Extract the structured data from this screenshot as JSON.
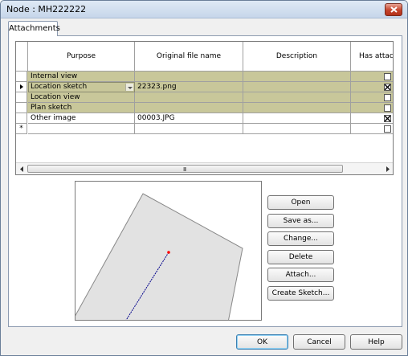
{
  "window": {
    "title": "Node : MH222222"
  },
  "tabs": [
    {
      "label": "Attachments"
    }
  ],
  "grid": {
    "columns": [
      "Purpose",
      "Original file name",
      "Description",
      "Has attachment"
    ],
    "rows": [
      {
        "purpose": "Internal view",
        "file": "",
        "description": "",
        "has_attachment": false,
        "highlighted": true
      },
      {
        "purpose": "Location sketch",
        "file": "22323.png",
        "description": "",
        "has_attachment": true,
        "highlighted": true,
        "current": true
      },
      {
        "purpose": "Location view",
        "file": "",
        "description": "",
        "has_attachment": false,
        "highlighted": true
      },
      {
        "purpose": "Plan sketch",
        "file": "",
        "description": "",
        "has_attachment": false,
        "highlighted": true
      },
      {
        "purpose": "Other image",
        "file": "00003.JPG",
        "description": "",
        "has_attachment": true,
        "highlighted": false
      }
    ],
    "new_row_marker": "*",
    "scroll_grip": "III"
  },
  "side_buttons": {
    "open": "Open",
    "save_as": "Save as...",
    "change": "Change...",
    "delete": "Delete",
    "attach": "Attach...",
    "create_sketch": "Create Sketch..."
  },
  "footer_buttons": {
    "ok": "OK",
    "cancel": "Cancel",
    "help": "Help"
  },
  "colors": {
    "highlight_row": "#c8c79a",
    "sketch_fill": "#e2e2e2",
    "sketch_line": "#00008b",
    "sketch_point": "#ff0000"
  }
}
